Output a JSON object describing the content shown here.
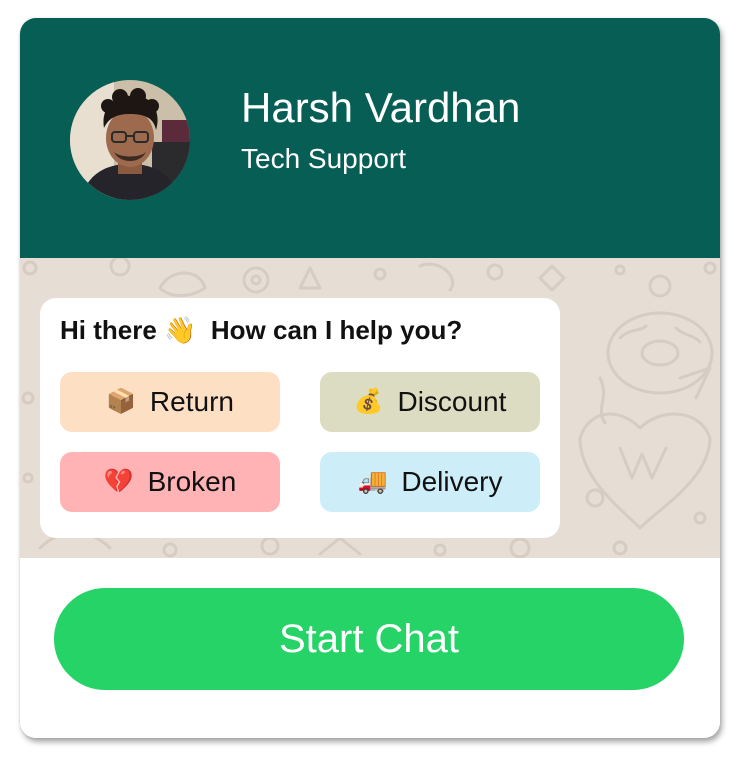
{
  "agent": {
    "name": "Harsh Vardhan",
    "role": "Tech Support",
    "avatar_icon": "person-avatar"
  },
  "message": {
    "greeting_part1": "Hi there",
    "greeting_emoji": "👋",
    "greeting_part2": "How can I help you?"
  },
  "options": [
    {
      "label": "Return",
      "emoji": "📦",
      "icon": "package-icon",
      "color": "#fde0c4"
    },
    {
      "label": "Discount",
      "emoji": "💰",
      "icon": "money-bag-icon",
      "color": "#dcdcc2"
    },
    {
      "label": "Broken",
      "emoji": "💔",
      "icon": "broken-heart-icon",
      "color": "#ffb3b5"
    },
    {
      "label": "Delivery",
      "emoji": "🚚",
      "icon": "truck-icon",
      "color": "#cdeef8"
    }
  ],
  "cta": {
    "label": "Start Chat",
    "color": "#25d366"
  },
  "colors": {
    "header": "#075e54",
    "chat_background": "#e6ddd5"
  }
}
